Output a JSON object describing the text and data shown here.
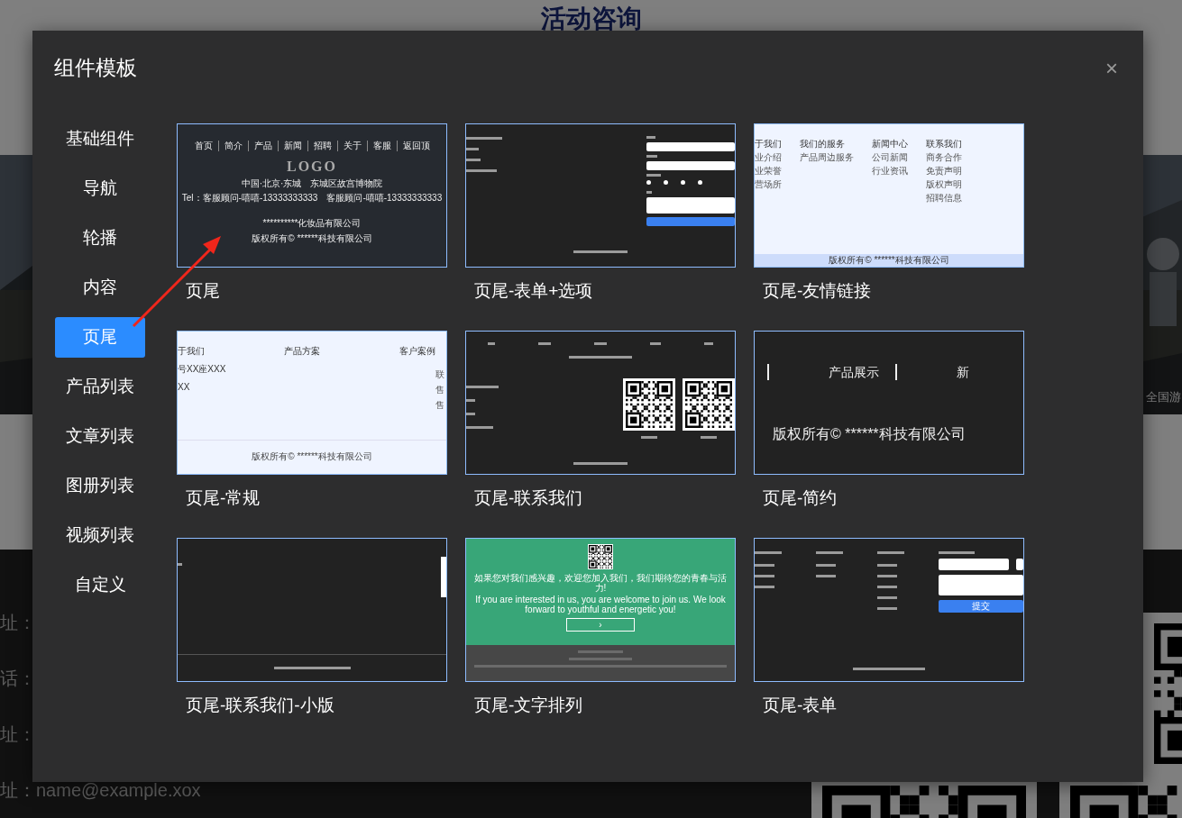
{
  "background": {
    "title": "活动咨询",
    "photo_caption": "全国游",
    "contact_lines": [
      "址：",
      "话：",
      "址：",
      "址：name@example.xox"
    ]
  },
  "dialog": {
    "title": "组件模板",
    "close": "×"
  },
  "sidebar": {
    "items": [
      {
        "label": "基础组件",
        "selected": false
      },
      {
        "label": "导航",
        "selected": false
      },
      {
        "label": "轮播",
        "selected": false
      },
      {
        "label": "内容",
        "selected": false
      },
      {
        "label": "页尾",
        "selected": true
      },
      {
        "label": "产品列表",
        "selected": false
      },
      {
        "label": "文章列表",
        "selected": false
      },
      {
        "label": "图册列表",
        "selected": false
      },
      {
        "label": "视频列表",
        "selected": false
      },
      {
        "label": "自定义",
        "selected": false
      }
    ]
  },
  "templates": [
    {
      "caption": "页尾",
      "preview": {
        "kind": "nav-logo",
        "nav": [
          "首页",
          "简介",
          "产品",
          "新闻",
          "招聘",
          "关于",
          "客服",
          "返回顶"
        ],
        "logo": "LOGO",
        "lines": [
          "中国·北京·东城　东城区故宫博物院",
          "Tel：客服顾问-嘻嘻-13333333333　客服顾问-嘻嘻-13333333333"
        ],
        "footer_lines": [
          "**********化妆品有限公司",
          "版权所有© ******科技有限公司"
        ]
      }
    },
    {
      "caption": "页尾-表单+选项",
      "preview": {
        "kind": "form",
        "options": [
          {
            "checked": false
          },
          {
            "checked": false
          },
          {
            "checked": false
          },
          {
            "checked": false
          }
        ]
      }
    },
    {
      "caption": "页尾-友情链接",
      "preview": {
        "kind": "link-columns",
        "columns": [
          {
            "title": "于我们",
            "items": [
              "业介绍",
              "业荣誉",
              "营场所"
            ]
          },
          {
            "title": "我们的服务",
            "items": [
              "产品周边服务"
            ]
          },
          {
            "title": "新闻中心",
            "items": [
              "公司新闻",
              "行业资讯"
            ]
          },
          {
            "title": "联系我们",
            "items": [
              "商务合作",
              "免责声明",
              "版权声明",
              "招聘信息"
            ]
          }
        ],
        "footer": "版权所有© ******科技有限公司"
      }
    },
    {
      "caption": "页尾-常规",
      "preview": {
        "kind": "columns-plain",
        "headings": [
          "于我们",
          "产品方案",
          "客户案例"
        ],
        "left_lines": [
          "号XX座XXX",
          "XX"
        ],
        "right_lines": [
          "联",
          "售",
          "售"
        ],
        "footer": "版权所有© ******科技有限公司"
      }
    },
    {
      "caption": "页尾-联系我们",
      "preview": {
        "kind": "contact-qr"
      }
    },
    {
      "caption": "页尾-简约",
      "preview": {
        "kind": "simple",
        "nav": [
          "产品展示",
          "新"
        ],
        "footer": "版权所有© ******科技有限公司"
      }
    },
    {
      "caption": "页尾-联系我们-小版",
      "preview": {
        "kind": "small"
      }
    },
    {
      "caption": "页尾-文字排列",
      "preview": {
        "kind": "green",
        "lines": [
          "如果您对我们感兴趣，欢迎您加入我们，我们期待您的青春与活力!",
          "If you are interested in us, you are welcome to join us. We look forward to youthful and energetic you!"
        ],
        "button": "›"
      }
    },
    {
      "caption": "页尾-表单",
      "preview": {
        "kind": "form-columns",
        "button": "提交"
      }
    }
  ]
}
